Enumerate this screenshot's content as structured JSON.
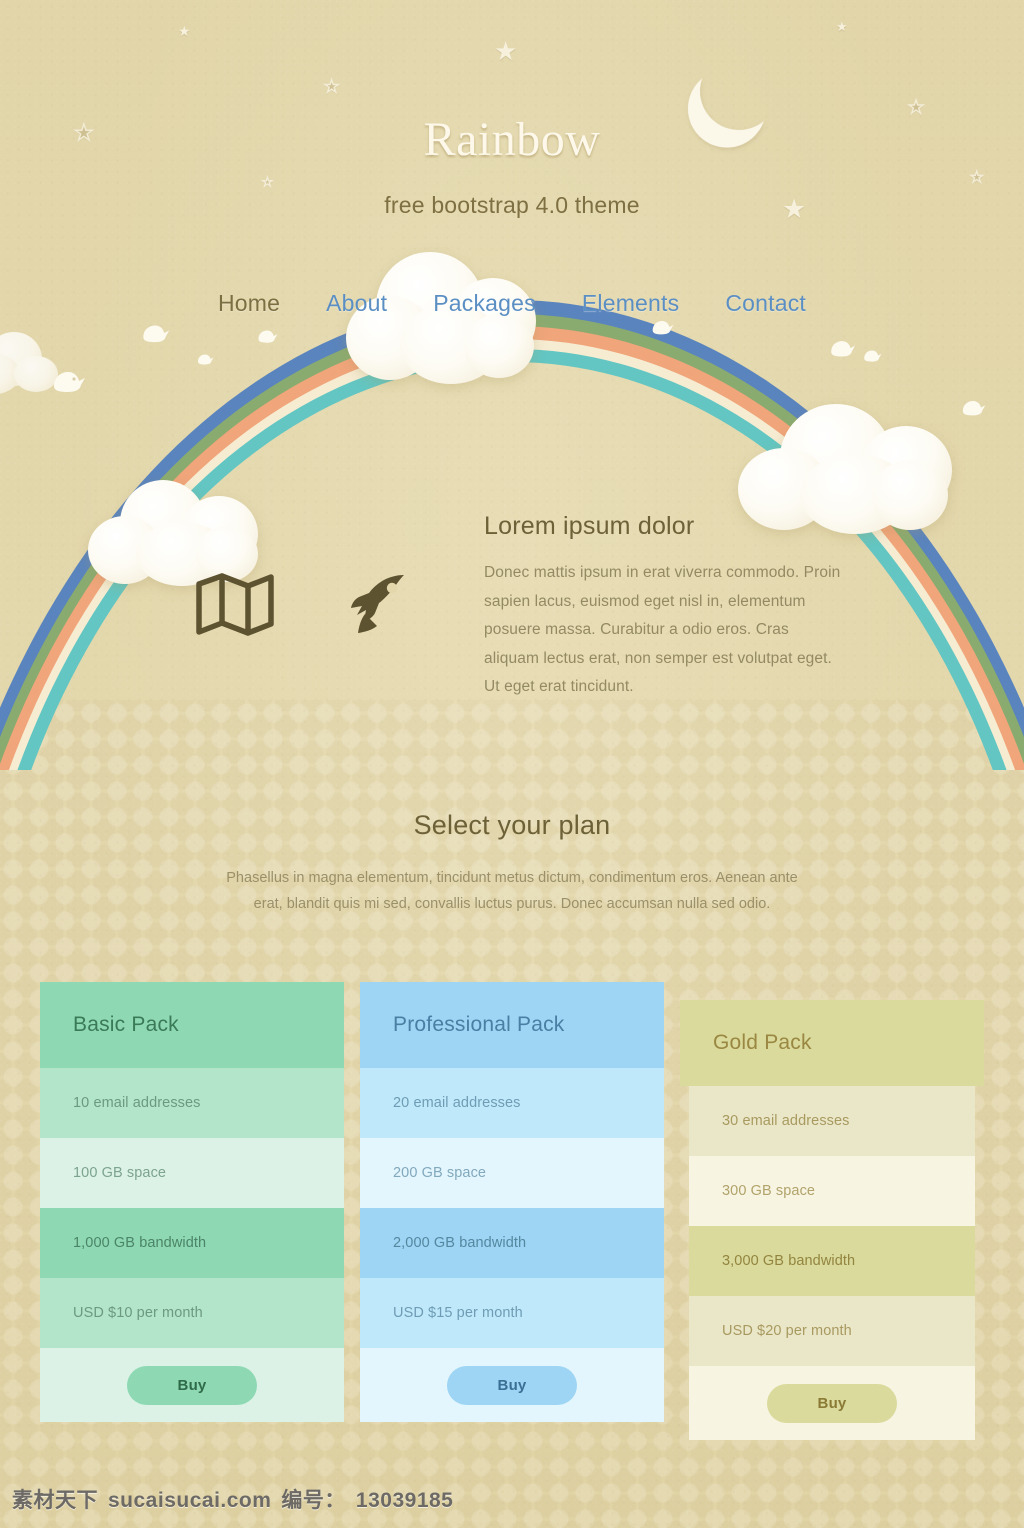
{
  "header": {
    "brand": "Rainbow",
    "tagline": "free bootstrap 4.0 theme"
  },
  "nav": {
    "items": [
      {
        "label": "Home",
        "active": true
      },
      {
        "label": "About",
        "active": false
      },
      {
        "label": "Packages",
        "active": false
      },
      {
        "label": "Elements",
        "active": false
      },
      {
        "label": "Contact",
        "active": false
      }
    ]
  },
  "intro": {
    "heading": "Lorem ipsum dolor",
    "body": "Donec mattis ipsum in erat viverra commodo. Proin sapien lacus, euismod eget nisl in, elementum posuere massa. Curabitur a odio eros. Cras aliquam lectus erat, non semper est volutpat eget. Ut eget erat tincidunt.",
    "icons": [
      {
        "name": "map-icon"
      },
      {
        "name": "rocket-icon"
      }
    ]
  },
  "plans_section": {
    "heading": "Select your plan",
    "description": "Phasellus in magna elementum, tincidunt metus dictum, condimentum eros. Aenean ante erat, blandit quis mi sed, convallis luctus purus. Donec accumsan nulla sed odio."
  },
  "plans": [
    {
      "title": "Basic Pack",
      "theme": "green",
      "accent": "#8ed9b4",
      "rows": [
        "10 email addresses",
        "100 GB space",
        "1,000 GB bandwidth",
        "USD $10 per month"
      ],
      "buy_label": "Buy"
    },
    {
      "title": "Professional Pack",
      "theme": "blue",
      "accent": "#9ed5f4",
      "rows": [
        "20 email addresses",
        "200 GB space",
        "2,000 GB bandwidth",
        "USD $15 per month"
      ],
      "buy_label": "Buy"
    },
    {
      "title": "Gold Pack",
      "theme": "gold",
      "accent": "#d9da9c",
      "rows": [
        "30 email addresses",
        "300 GB space",
        "3,000 GB bandwidth",
        "USD $20 per month"
      ],
      "buy_label": "Buy"
    }
  ],
  "decor": {
    "moon": "crescent-moon-icon",
    "rainbow_colors": [
      "#5a84bd",
      "#8aab70",
      "#f0a57a",
      "#f6ecd2",
      "#63c6c2"
    ],
    "background_color": "#e2d6ab"
  },
  "watermark": {
    "site_cn": "素材天下",
    "site": "sucaisucai.com",
    "id_label": "编号：",
    "id_value": "13039185"
  }
}
